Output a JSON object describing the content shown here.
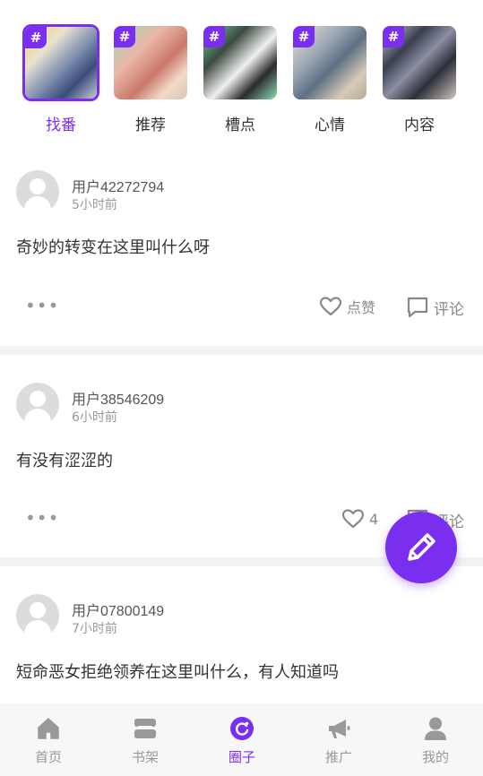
{
  "topics": [
    {
      "label": "找番",
      "active": true
    },
    {
      "label": "推荐",
      "active": false
    },
    {
      "label": "槽点",
      "active": false
    },
    {
      "label": "心情",
      "active": false
    },
    {
      "label": "内容",
      "active": false
    }
  ],
  "topic_badge": "#",
  "posts": [
    {
      "user": "用户42272794",
      "time": "5小时前",
      "content": "奇妙的转变在这里叫什么呀",
      "like_label": "点赞",
      "comment_label": "评论"
    },
    {
      "user": "用户38546209",
      "time": "6小时前",
      "content": "有没有涩涩的",
      "like_label": "4",
      "comment_label": "评论"
    },
    {
      "user": "用户07800149",
      "time": "7小时前",
      "content": "短命恶女拒绝领养在这里叫什么，有人知道吗"
    }
  ],
  "more_label": "•••",
  "nav": [
    {
      "label": "首页",
      "icon": "home-icon",
      "active": false
    },
    {
      "label": "书架",
      "icon": "bookshelf-icon",
      "active": false
    },
    {
      "label": "圈子",
      "icon": "circle-icon",
      "active": true
    },
    {
      "label": "推广",
      "icon": "megaphone-icon",
      "active": false
    },
    {
      "label": "我的",
      "icon": "profile-icon",
      "active": false
    }
  ],
  "colors": {
    "accent": "#7a2ef0",
    "inactive": "#999999",
    "divider": "#f3f3f3"
  }
}
